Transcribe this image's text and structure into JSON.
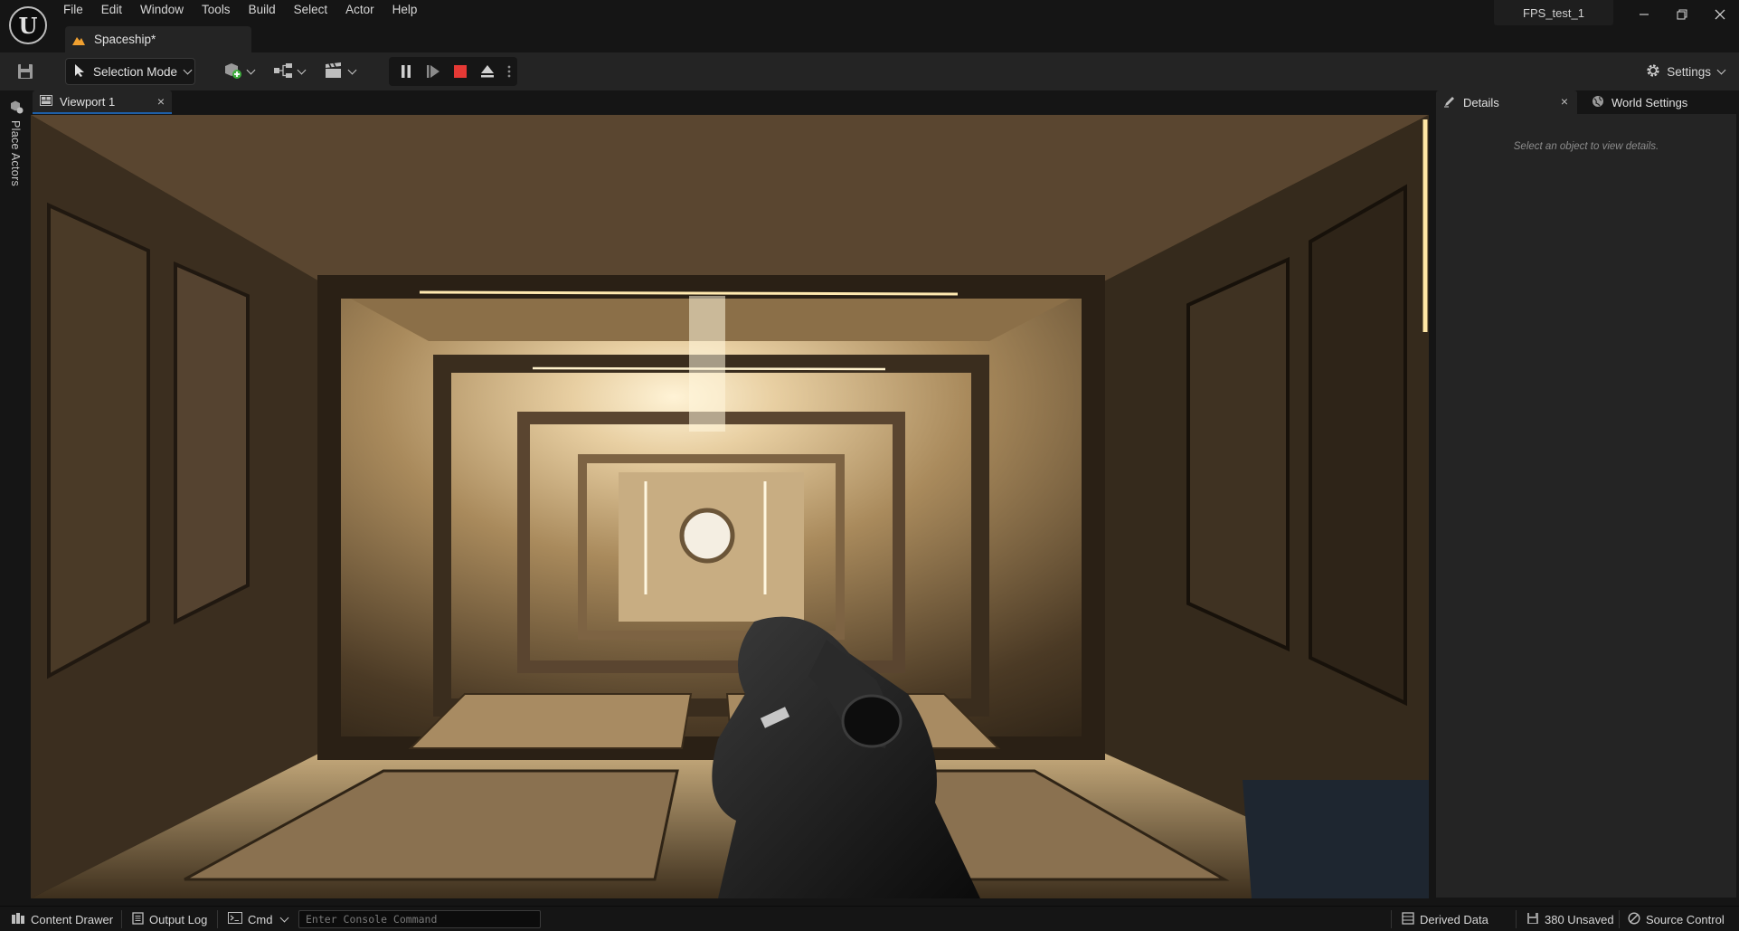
{
  "app": {
    "logo_text": "U",
    "project_name": "FPS_test_1"
  },
  "menu": [
    "File",
    "Edit",
    "Window",
    "Tools",
    "Build",
    "Select",
    "Actor",
    "Help"
  ],
  "document_tab": {
    "label": "Spaceship*"
  },
  "toolbar": {
    "mode_label": "Selection Mode",
    "settings_label": "Settings"
  },
  "left_strip": {
    "place_actors_label": "Place Actors"
  },
  "viewport": {
    "tab_label": "Viewport 1",
    "close_glyph": "×"
  },
  "right_panel": {
    "details_tab": "Details",
    "world_settings_tab": "World Settings",
    "close_glyph": "×",
    "hint": "Select an object to view details."
  },
  "statusbar": {
    "content_drawer": "Content Drawer",
    "output_log": "Output Log",
    "cmd": "Cmd",
    "console_placeholder": "Enter Console Command",
    "derived_data": "Derived Data",
    "unsaved": "380 Unsaved",
    "source_control": "Source Control"
  },
  "colors": {
    "accent_blue": "#1e5fa8",
    "stop_red": "#e53935",
    "level_icon": "#f0a030"
  },
  "icons": {
    "window_minimize": "minimize-icon",
    "window_restore": "restore-icon",
    "window_close": "close-icon"
  }
}
